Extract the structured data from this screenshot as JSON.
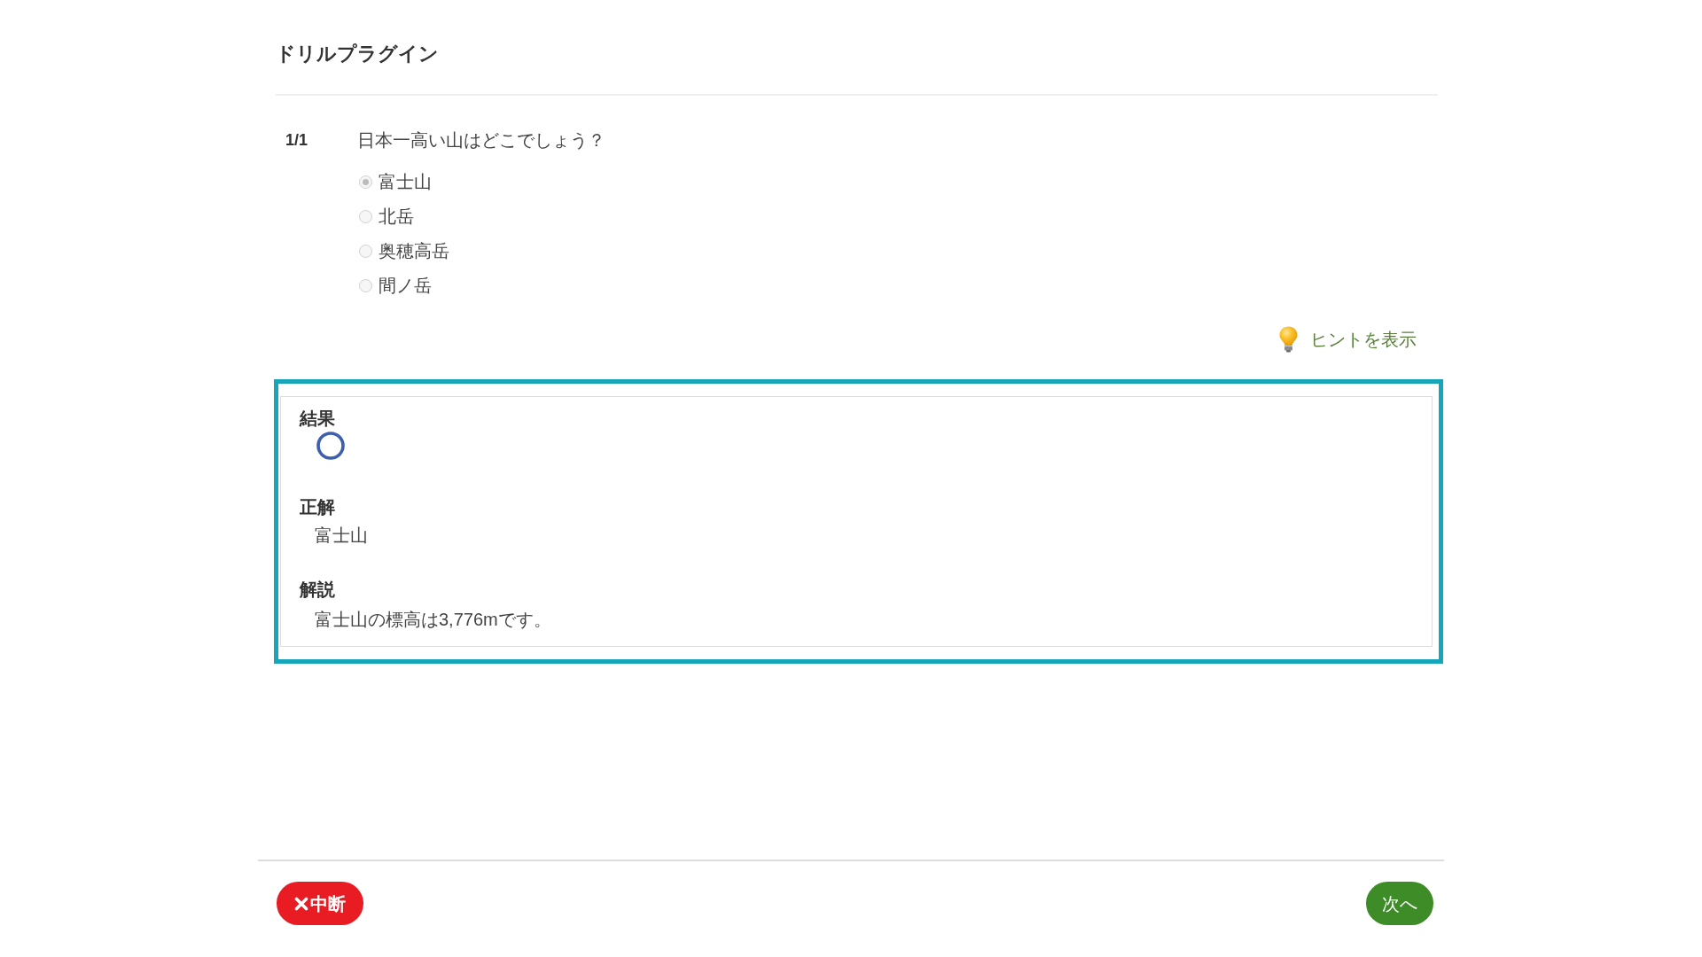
{
  "title": "ドリルプラグイン",
  "question": {
    "number": "1/1",
    "text": "日本一高い山はどこでしょう？",
    "choices": [
      {
        "label": "富士山",
        "selected": true,
        "disabled": true
      },
      {
        "label": "北岳",
        "selected": false,
        "disabled": true
      },
      {
        "label": "奥穂高岳",
        "selected": false,
        "disabled": true
      },
      {
        "label": "間ノ岳",
        "selected": false,
        "disabled": true
      }
    ]
  },
  "hint_link": {
    "label": "ヒントを表示"
  },
  "result_panel": {
    "result_label": "結果",
    "correct": true,
    "answer_label": "正解",
    "answer": "富士山",
    "explanation_label": "解説",
    "explanation": "富士山の標高は3,776mです。"
  },
  "buttons": [
    {
      "kind": "abort",
      "label": "中断"
    },
    {
      "kind": "next",
      "label": "次へ"
    }
  ]
}
